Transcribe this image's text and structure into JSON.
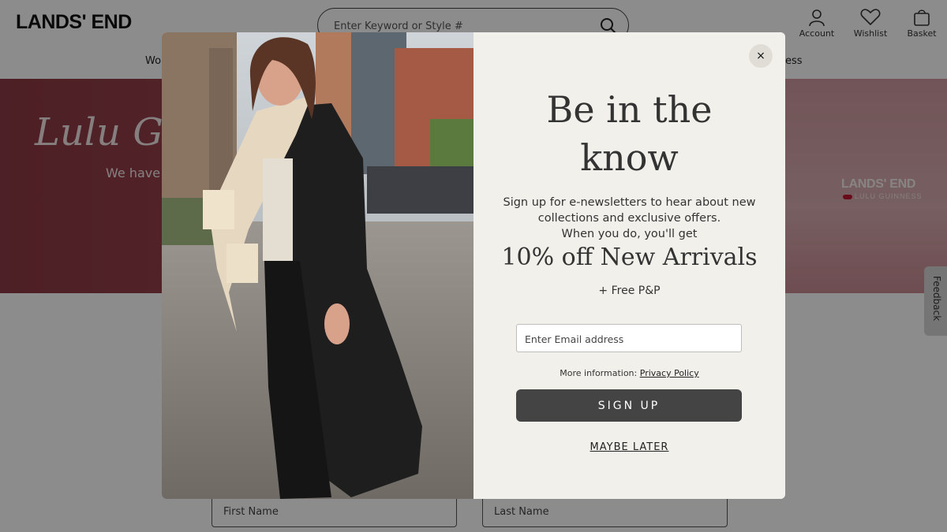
{
  "header": {
    "logo": "LANDS' END",
    "search": {
      "placeholder": "Enter Keyword or Style #"
    },
    "utility": [
      {
        "label": "Account",
        "icon": "user-icon"
      },
      {
        "label": "Wishlist",
        "icon": "heart-icon"
      },
      {
        "label": "Basket",
        "icon": "bag-icon"
      }
    ],
    "nav": {
      "left_partial": "Wo",
      "right_partial": "ess"
    }
  },
  "hero": {
    "title_partial": "Lulu Gu",
    "subtitle_partial": "We have",
    "brand": "LANDS' END",
    "brand_sub": "LULU GUINNESS"
  },
  "form_background": {
    "first_name_placeholder": "First Name",
    "last_name_placeholder": "Last Name"
  },
  "feedback": {
    "label": "Feedback"
  },
  "modal": {
    "close_label": "×",
    "headline_line1": "Be in the",
    "headline_line2": "know",
    "description_line1": "Sign up for e-newsletters to hear about new",
    "description_line2": "collections and exclusive offers.",
    "description_line3": "When you do, you'll get",
    "offer": "10% off New Arrivals",
    "extra": "+ Free P&P",
    "email_placeholder": "Enter Email address",
    "more_info_prefix": "More information:",
    "privacy_link": "Privacy Policy",
    "signup_label": "SIGN UP",
    "maybe_later_label": "MAYBE LATER"
  },
  "colors": {
    "overlay": "rgba(0,0,0,0.45)",
    "modal_bg": "#f2f0eb",
    "button_bg": "#444444",
    "hero_bg": "#a24a55"
  }
}
